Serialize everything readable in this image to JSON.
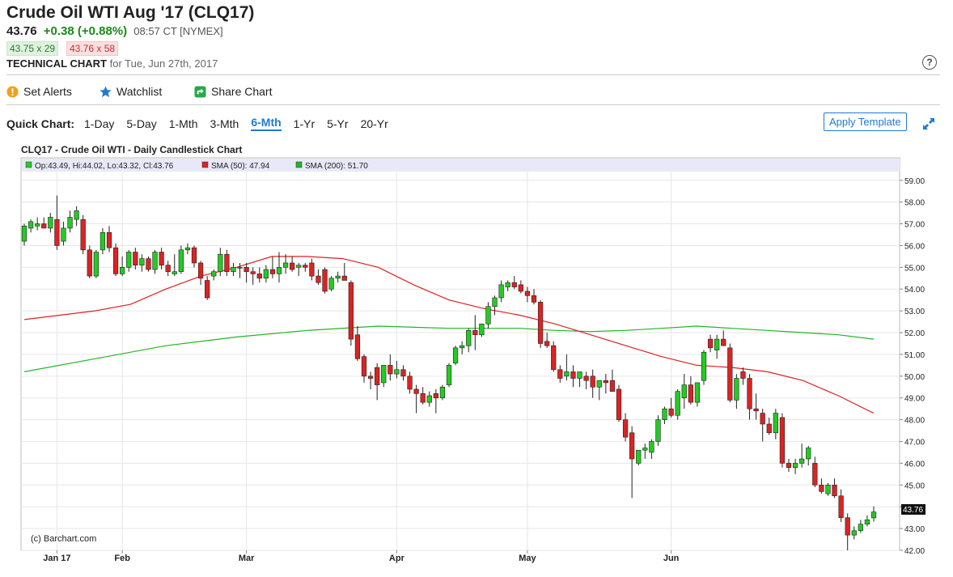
{
  "header": {
    "title": "Crude Oil WTI Aug '17 (CLQ17)",
    "last": "43.76",
    "change": "+0.38 (+0.88%)",
    "time": "08:57 CT [NYMEX]",
    "bid": "43.75 x 29",
    "ask": "43.76 x 58",
    "chart_type_label": "TECHNICAL CHART",
    "chart_date": "for Tue, Jun 27th, 2017"
  },
  "toolbar": {
    "set_alerts": "Set Alerts",
    "watchlist": "Watchlist",
    "share_chart": "Share Chart"
  },
  "quick_chart": {
    "label": "Quick Chart:",
    "ranges": [
      "1-Day",
      "5-Day",
      "1-Mth",
      "3-Mth",
      "6-Mth",
      "1-Yr",
      "5-Yr",
      "20-Yr"
    ],
    "active": "6-Mth",
    "apply_template": "Apply Template"
  },
  "colors": {
    "up": "#22cc22",
    "down": "#dd2222",
    "sma50": "#e02020",
    "sma200": "#22b522",
    "accent": "#1e7bd0",
    "legend_bg": "#e8e8f8"
  },
  "chart_data": {
    "type": "candlestick",
    "title": "CLQ17 - Crude Oil WTI - Daily Candlestick Chart",
    "legend": {
      "ohlc": "Op:43.49, Hi:44.02, Lo:43.32, Cl:43.76",
      "sma50": "SMA (50): 47.94",
      "sma200": "SMA (200): 51.70"
    },
    "watermark": "(c) Barchart.com",
    "last_price_label": "43.76",
    "ylim": [
      42,
      59.4
    ],
    "y_ticks": [
      "59.00",
      "58.00",
      "57.00",
      "56.00",
      "55.00",
      "54.00",
      "53.00",
      "52.00",
      "51.00",
      "50.00",
      "49.00",
      "48.00",
      "47.00",
      "46.00",
      "45.00",
      "44.00",
      "43.00",
      "42.00"
    ],
    "x_ticks": [
      {
        "label": "Jan 17",
        "index": 5
      },
      {
        "label": "Feb",
        "index": 15
      },
      {
        "label": "Mar",
        "index": 34
      },
      {
        "label": "Apr",
        "index": 57
      },
      {
        "label": "May",
        "index": 77
      },
      {
        "label": "Jun",
        "index": 99
      }
    ],
    "candles": [
      {
        "o": 56.2,
        "h": 57.0,
        "l": 56.0,
        "c": 56.9
      },
      {
        "o": 56.8,
        "h": 57.2,
        "l": 56.6,
        "c": 57.1
      },
      {
        "o": 56.9,
        "h": 57.3,
        "l": 56.7,
        "c": 57.0
      },
      {
        "o": 57.0,
        "h": 57.3,
        "l": 56.8,
        "c": 56.8
      },
      {
        "o": 56.8,
        "h": 57.5,
        "l": 56.6,
        "c": 57.3
      },
      {
        "o": 57.2,
        "h": 58.3,
        "l": 55.8,
        "c": 56.0
      },
      {
        "o": 56.2,
        "h": 57.1,
        "l": 56.0,
        "c": 56.8
      },
      {
        "o": 56.8,
        "h": 57.6,
        "l": 56.6,
        "c": 57.3
      },
      {
        "o": 57.2,
        "h": 57.8,
        "l": 56.9,
        "c": 57.6
      },
      {
        "o": 57.2,
        "h": 57.4,
        "l": 55.6,
        "c": 55.8
      },
      {
        "o": 55.8,
        "h": 56.0,
        "l": 54.5,
        "c": 54.6
      },
      {
        "o": 54.6,
        "h": 55.8,
        "l": 54.5,
        "c": 55.7
      },
      {
        "o": 55.8,
        "h": 56.8,
        "l": 55.6,
        "c": 56.6
      },
      {
        "o": 56.6,
        "h": 56.9,
        "l": 55.7,
        "c": 55.9
      },
      {
        "o": 55.9,
        "h": 56.1,
        "l": 54.6,
        "c": 54.7
      },
      {
        "o": 54.7,
        "h": 55.5,
        "l": 54.6,
        "c": 55.0
      },
      {
        "o": 55.0,
        "h": 55.8,
        "l": 54.8,
        "c": 55.7
      },
      {
        "o": 55.7,
        "h": 55.9,
        "l": 54.9,
        "c": 55.1
      },
      {
        "o": 55.1,
        "h": 55.6,
        "l": 54.8,
        "c": 55.4
      },
      {
        "o": 55.4,
        "h": 55.5,
        "l": 54.8,
        "c": 54.9
      },
      {
        "o": 54.9,
        "h": 55.8,
        "l": 54.7,
        "c": 55.7
      },
      {
        "o": 55.7,
        "h": 55.9,
        "l": 54.9,
        "c": 55.1
      },
      {
        "o": 55.1,
        "h": 55.3,
        "l": 54.6,
        "c": 54.8
      },
      {
        "o": 54.7,
        "h": 55.6,
        "l": 54.6,
        "c": 54.8
      },
      {
        "o": 54.8,
        "h": 56.0,
        "l": 54.7,
        "c": 55.8
      },
      {
        "o": 55.8,
        "h": 56.1,
        "l": 55.6,
        "c": 55.9
      },
      {
        "o": 55.9,
        "h": 56.0,
        "l": 55.0,
        "c": 55.2
      },
      {
        "o": 55.2,
        "h": 55.3,
        "l": 54.2,
        "c": 54.5
      },
      {
        "o": 54.4,
        "h": 54.6,
        "l": 53.5,
        "c": 53.6
      },
      {
        "o": 54.6,
        "h": 54.9,
        "l": 54.4,
        "c": 54.8
      },
      {
        "o": 54.8,
        "h": 55.9,
        "l": 54.6,
        "c": 55.6
      },
      {
        "o": 55.6,
        "h": 55.8,
        "l": 54.6,
        "c": 54.8
      },
      {
        "o": 54.8,
        "h": 55.2,
        "l": 54.6,
        "c": 55.0
      },
      {
        "o": 55.0,
        "h": 55.2,
        "l": 54.5,
        "c": 55.0
      },
      {
        "o": 55.0,
        "h": 55.2,
        "l": 54.3,
        "c": 54.8
      },
      {
        "o": 54.8,
        "h": 55.0,
        "l": 54.2,
        "c": 54.7
      },
      {
        "o": 54.7,
        "h": 55.0,
        "l": 54.3,
        "c": 54.5
      },
      {
        "o": 54.5,
        "h": 55.1,
        "l": 54.3,
        "c": 54.9
      },
      {
        "o": 54.9,
        "h": 55.5,
        "l": 54.5,
        "c": 54.7
      },
      {
        "o": 54.7,
        "h": 55.7,
        "l": 54.3,
        "c": 55.0
      },
      {
        "o": 55.0,
        "h": 55.6,
        "l": 54.7,
        "c": 55.2
      },
      {
        "o": 55.2,
        "h": 55.5,
        "l": 54.8,
        "c": 54.9
      },
      {
        "o": 55.0,
        "h": 55.2,
        "l": 54.6,
        "c": 55.1
      },
      {
        "o": 55.1,
        "h": 55.2,
        "l": 54.8,
        "c": 55.0
      },
      {
        "o": 55.2,
        "h": 55.4,
        "l": 54.4,
        "c": 54.6
      },
      {
        "o": 54.6,
        "h": 54.9,
        "l": 54.2,
        "c": 54.3
      },
      {
        "o": 54.9,
        "h": 55.0,
        "l": 53.8,
        "c": 53.9
      },
      {
        "o": 54.0,
        "h": 54.6,
        "l": 53.9,
        "c": 54.5
      },
      {
        "o": 54.5,
        "h": 54.8,
        "l": 54.3,
        "c": 54.6
      },
      {
        "o": 54.6,
        "h": 55.2,
        "l": 54.4,
        "c": 54.4
      },
      {
        "o": 54.3,
        "h": 54.4,
        "l": 51.4,
        "c": 51.7
      },
      {
        "o": 51.9,
        "h": 52.3,
        "l": 50.7,
        "c": 50.8
      },
      {
        "o": 50.9,
        "h": 51.0,
        "l": 49.7,
        "c": 50.0
      },
      {
        "o": 50.0,
        "h": 50.2,
        "l": 49.4,
        "c": 49.9
      },
      {
        "o": 50.4,
        "h": 50.6,
        "l": 48.9,
        "c": 49.6
      },
      {
        "o": 49.7,
        "h": 50.5,
        "l": 49.5,
        "c": 50.5
      },
      {
        "o": 50.5,
        "h": 51.0,
        "l": 49.8,
        "c": 50.1
      },
      {
        "o": 50.1,
        "h": 50.7,
        "l": 49.9,
        "c": 50.3
      },
      {
        "o": 50.3,
        "h": 50.5,
        "l": 49.8,
        "c": 50.0
      },
      {
        "o": 50.0,
        "h": 50.2,
        "l": 49.2,
        "c": 49.4
      },
      {
        "o": 49.4,
        "h": 49.6,
        "l": 48.3,
        "c": 49.2
      },
      {
        "o": 49.2,
        "h": 49.5,
        "l": 48.7,
        "c": 48.8
      },
      {
        "o": 48.8,
        "h": 49.3,
        "l": 48.6,
        "c": 49.1
      },
      {
        "o": 49.2,
        "h": 49.4,
        "l": 48.3,
        "c": 49.0
      },
      {
        "o": 49.0,
        "h": 49.6,
        "l": 48.9,
        "c": 49.5
      },
      {
        "o": 49.6,
        "h": 50.6,
        "l": 49.5,
        "c": 50.5
      },
      {
        "o": 50.6,
        "h": 51.4,
        "l": 50.5,
        "c": 51.3
      },
      {
        "o": 51.3,
        "h": 51.6,
        "l": 51.0,
        "c": 51.4
      },
      {
        "o": 51.4,
        "h": 52.2,
        "l": 51.1,
        "c": 52.1
      },
      {
        "o": 52.1,
        "h": 52.8,
        "l": 51.2,
        "c": 51.9
      },
      {
        "o": 51.9,
        "h": 52.4,
        "l": 51.8,
        "c": 52.4
      },
      {
        "o": 52.4,
        "h": 53.4,
        "l": 52.2,
        "c": 53.2
      },
      {
        "o": 53.2,
        "h": 53.7,
        "l": 52.8,
        "c": 53.6
      },
      {
        "o": 53.6,
        "h": 54.4,
        "l": 53.4,
        "c": 54.2
      },
      {
        "o": 54.1,
        "h": 54.4,
        "l": 53.9,
        "c": 54.3
      },
      {
        "o": 54.3,
        "h": 54.6,
        "l": 54.0,
        "c": 54.1
      },
      {
        "o": 54.2,
        "h": 54.4,
        "l": 53.8,
        "c": 53.9
      },
      {
        "o": 53.9,
        "h": 54.1,
        "l": 53.4,
        "c": 53.7
      },
      {
        "o": 53.7,
        "h": 54.0,
        "l": 53.3,
        "c": 53.4
      },
      {
        "o": 53.4,
        "h": 53.5,
        "l": 51.3,
        "c": 51.5
      },
      {
        "o": 51.6,
        "h": 52.0,
        "l": 51.3,
        "c": 51.4
      },
      {
        "o": 51.4,
        "h": 51.6,
        "l": 50.2,
        "c": 50.3
      },
      {
        "o": 50.3,
        "h": 50.5,
        "l": 49.7,
        "c": 49.9
      },
      {
        "o": 50.0,
        "h": 51.0,
        "l": 49.8,
        "c": 50.2
      },
      {
        "o": 50.2,
        "h": 50.5,
        "l": 49.5,
        "c": 49.9
      },
      {
        "o": 49.9,
        "h": 50.2,
        "l": 49.5,
        "c": 50.2
      },
      {
        "o": 50.0,
        "h": 50.2,
        "l": 49.4,
        "c": 49.8
      },
      {
        "o": 50.0,
        "h": 50.3,
        "l": 49.0,
        "c": 49.5
      },
      {
        "o": 49.5,
        "h": 49.8,
        "l": 48.9,
        "c": 49.8
      },
      {
        "o": 49.8,
        "h": 50.1,
        "l": 49.2,
        "c": 49.7
      },
      {
        "o": 49.8,
        "h": 50.3,
        "l": 49.4,
        "c": 49.3
      }
    ],
    "sma50": [
      [
        0,
        52.6
      ],
      [
        5,
        52.8
      ],
      [
        10,
        53.0
      ],
      [
        15,
        53.3
      ],
      [
        20,
        54.0
      ],
      [
        25,
        54.6
      ],
      [
        30,
        55.0
      ],
      [
        35,
        55.5
      ],
      [
        40,
        55.5
      ],
      [
        45,
        55.4
      ],
      [
        50,
        55.0
      ],
      [
        55,
        54.2
      ],
      [
        60,
        53.5
      ],
      [
        65,
        53.1
      ],
      [
        70,
        52.8
      ],
      [
        75,
        52.4
      ]
    ],
    "sma200": [
      [
        0,
        50.2
      ],
      [
        10,
        50.8
      ],
      [
        20,
        51.4
      ],
      [
        30,
        51.8
      ],
      [
        40,
        52.1
      ],
      [
        50,
        52.3
      ],
      [
        60,
        52.2
      ],
      [
        70,
        52.2
      ],
      [
        75,
        52.1
      ]
    ],
    "sma50_tail": [
      [
        75,
        52.4
      ],
      [
        80,
        51.9
      ],
      [
        85,
        51.4
      ],
      [
        90,
        50.9
      ],
      [
        95,
        50.5
      ],
      [
        100,
        50.4
      ],
      [
        105,
        50.2
      ],
      [
        110,
        49.8
      ],
      [
        115,
        49.1
      ],
      [
        120,
        48.3
      ]
    ],
    "sma200_tail": [
      [
        75,
        52.1
      ],
      [
        80,
        52.05
      ],
      [
        85,
        52.1
      ],
      [
        90,
        52.2
      ],
      [
        95,
        52.3
      ],
      [
        100,
        52.2
      ],
      [
        105,
        52.1
      ],
      [
        110,
        52.0
      ],
      [
        115,
        51.9
      ],
      [
        120,
        51.7
      ]
    ],
    "candles_tail": [
      {
        "o": 49.4,
        "h": 49.6,
        "l": 47.9,
        "c": 48.0
      },
      {
        "o": 48.0,
        "h": 48.3,
        "l": 47.0,
        "c": 47.2
      },
      {
        "o": 47.4,
        "h": 47.7,
        "l": 44.4,
        "c": 46.2
      },
      {
        "o": 46.0,
        "h": 46.4,
        "l": 45.9,
        "c": 46.6
      },
      {
        "o": 46.6,
        "h": 46.9,
        "l": 46.2,
        "c": 46.7
      },
      {
        "o": 46.5,
        "h": 47.1,
        "l": 46.2,
        "c": 47.0
      },
      {
        "o": 47.0,
        "h": 48.2,
        "l": 46.8,
        "c": 48.0
      },
      {
        "o": 48.0,
        "h": 48.6,
        "l": 47.8,
        "c": 48.5
      },
      {
        "o": 48.5,
        "h": 49.0,
        "l": 48.1,
        "c": 48.2
      },
      {
        "o": 48.2,
        "h": 49.4,
        "l": 48.0,
        "c": 49.3
      },
      {
        "o": 49.0,
        "h": 50.1,
        "l": 48.5,
        "c": 49.6
      },
      {
        "o": 49.6,
        "h": 50.0,
        "l": 48.7,
        "c": 48.8
      },
      {
        "o": 48.8,
        "h": 49.7,
        "l": 48.6,
        "c": 49.7
      },
      {
        "o": 49.8,
        "h": 51.2,
        "l": 49.6,
        "c": 51.1
      },
      {
        "o": 51.7,
        "h": 51.9,
        "l": 51.1,
        "c": 51.3
      },
      {
        "o": 51.2,
        "h": 51.9,
        "l": 50.8,
        "c": 51.7
      },
      {
        "o": 51.7,
        "h": 52.1,
        "l": 51.4,
        "c": 51.4
      },
      {
        "o": 51.3,
        "h": 51.5,
        "l": 48.8,
        "c": 48.9
      },
      {
        "o": 48.9,
        "h": 50.1,
        "l": 48.5,
        "c": 49.9
      },
      {
        "o": 50.2,
        "h": 50.4,
        "l": 49.6,
        "c": 49.9
      },
      {
        "o": 49.9,
        "h": 50.1,
        "l": 48.0,
        "c": 48.5
      },
      {
        "o": 48.5,
        "h": 49.2,
        "l": 48.0,
        "c": 48.4
      },
      {
        "o": 48.3,
        "h": 48.5,
        "l": 47.0,
        "c": 47.8
      },
      {
        "o": 47.8,
        "h": 48.1,
        "l": 47.3,
        "c": 47.4
      },
      {
        "o": 47.4,
        "h": 48.5,
        "l": 47.1,
        "c": 48.3
      },
      {
        "o": 48.1,
        "h": 48.3,
        "l": 45.8,
        "c": 46.0
      },
      {
        "o": 46.0,
        "h": 46.2,
        "l": 45.6,
        "c": 45.8
      },
      {
        "o": 45.8,
        "h": 46.2,
        "l": 45.5,
        "c": 46.0
      },
      {
        "o": 46.0,
        "h": 46.9,
        "l": 45.8,
        "c": 46.2
      },
      {
        "o": 46.2,
        "h": 46.8,
        "l": 45.9,
        "c": 46.7
      },
      {
        "o": 46.0,
        "h": 46.3,
        "l": 44.9,
        "c": 45.0
      },
      {
        "o": 45.0,
        "h": 45.3,
        "l": 44.6,
        "c": 44.7
      },
      {
        "o": 44.6,
        "h": 45.1,
        "l": 44.5,
        "c": 45.0
      },
      {
        "o": 45.0,
        "h": 45.3,
        "l": 44.4,
        "c": 44.5
      },
      {
        "o": 44.5,
        "h": 44.8,
        "l": 43.3,
        "c": 43.5
      },
      {
        "o": 43.5,
        "h": 43.7,
        "l": 42.0,
        "c": 42.7
      },
      {
        "o": 42.7,
        "h": 43.1,
        "l": 42.5,
        "c": 42.9
      },
      {
        "o": 42.9,
        "h": 43.4,
        "l": 42.8,
        "c": 43.2
      },
      {
        "o": 43.2,
        "h": 43.6,
        "l": 43.1,
        "c": 43.4
      },
      {
        "o": 43.49,
        "h": 44.02,
        "l": 43.32,
        "c": 43.76
      }
    ]
  }
}
